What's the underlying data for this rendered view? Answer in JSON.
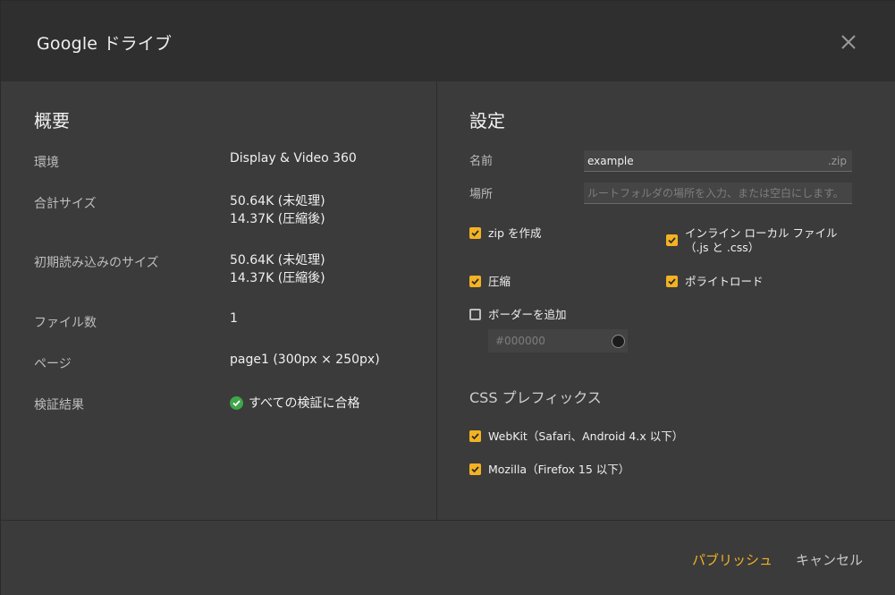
{
  "dialog": {
    "title": "Google ドライブ",
    "close_icon": "close-icon"
  },
  "summary": {
    "heading": "概要",
    "rows": [
      {
        "label": "環境",
        "value": "Display & Video 360",
        "value2": ""
      },
      {
        "label": "合計サイズ",
        "value": "50.64K (未処理)",
        "value2": "14.37K (圧縮後)"
      },
      {
        "label": "初期読み込みのサイズ",
        "value": "50.64K (未処理)",
        "value2": "14.37K (圧縮後)"
      },
      {
        "label": "ファイル数",
        "value": "1",
        "value2": ""
      },
      {
        "label": "ページ",
        "value": "page1 (300px × 250px)",
        "value2": ""
      },
      {
        "label": "検証結果",
        "value": "すべての検証に合格",
        "value2": ""
      }
    ]
  },
  "settings": {
    "heading": "設定",
    "name_label": "名前",
    "name_value": "example",
    "name_suffix": ".zip",
    "location_label": "場所",
    "location_placeholder": "ルートフォルダの場所を入力、または空白にします。",
    "options": {
      "create_zip": {
        "label": "zip を作成",
        "checked": true
      },
      "inline_local": {
        "label": "インライン ローカル ファイル（.js と .css）",
        "checked": true
      },
      "compress": {
        "label": "圧縮",
        "checked": true
      },
      "polite_load": {
        "label": "ポライトロード",
        "checked": true
      },
      "add_border": {
        "label": "ボーダーを追加",
        "checked": false
      }
    },
    "border_color_placeholder": "#000000",
    "css_prefix_heading": "CSS プレフィックス",
    "prefixes": {
      "webkit": {
        "label": "WebKit（Safari、Android 4.x 以下）",
        "checked": true
      },
      "mozilla": {
        "label": "Mozilla（Firefox 15 以下）",
        "checked": true
      }
    }
  },
  "footer": {
    "publish_label": "パブリッシュ",
    "cancel_label": "キャンセル"
  },
  "colors": {
    "accent": "#f3b223",
    "success": "#3fa64a",
    "titlebar": "#2f2f2f",
    "panel": "#3b3b3b"
  }
}
